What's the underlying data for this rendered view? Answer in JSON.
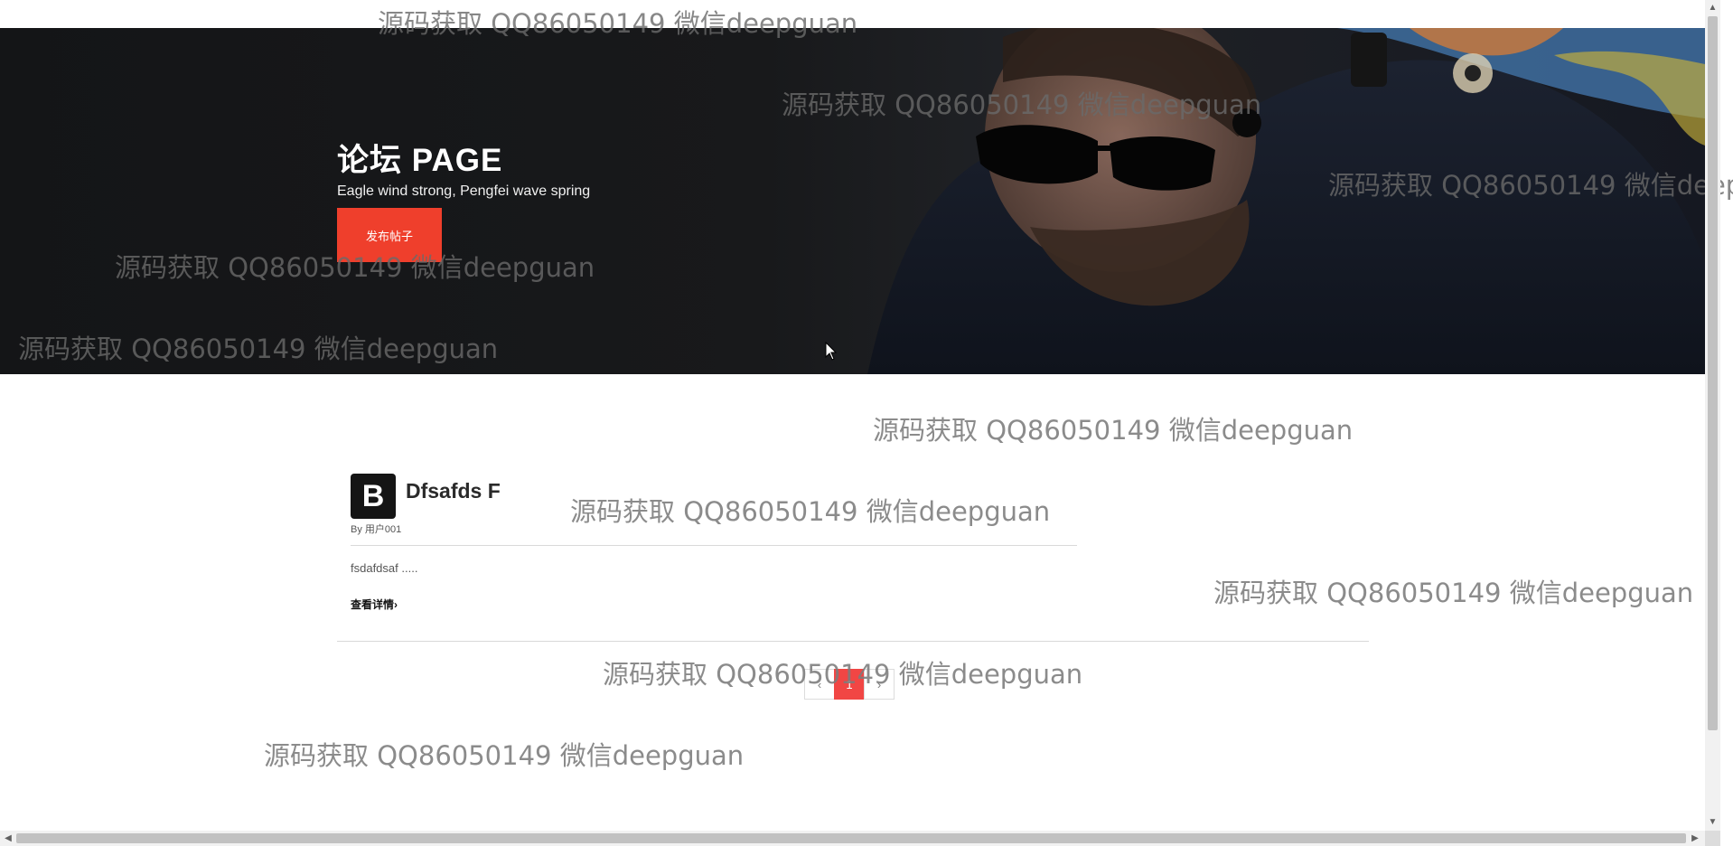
{
  "hero": {
    "title": "论坛 PAGE",
    "subtitle": "Eagle wind strong, Pengfei wave spring",
    "button_label": "发布帖子",
    "accent_color": "#ef3f2c"
  },
  "posts": [
    {
      "avatar_letter": "B",
      "title": "Dfsafds F",
      "author": "By 用户001",
      "excerpt": "fsdafdsaf .....",
      "more_label": "查看详情",
      "more_icon": "chevron-right-icon",
      "more_glyph": "›"
    }
  ],
  "pagination": {
    "prev_icon": "chevron-left-icon",
    "prev_glyph": "‹",
    "current_page": "1",
    "next_icon": "chevron-right-icon",
    "next_glyph": "›",
    "active_color": "#f14644"
  },
  "watermark_text": "源码获取 QQ86050149 微信deepguan",
  "scrollbars": {
    "up_glyph": "▲",
    "down_glyph": "▼",
    "left_glyph": "◀",
    "right_glyph": "▶"
  }
}
